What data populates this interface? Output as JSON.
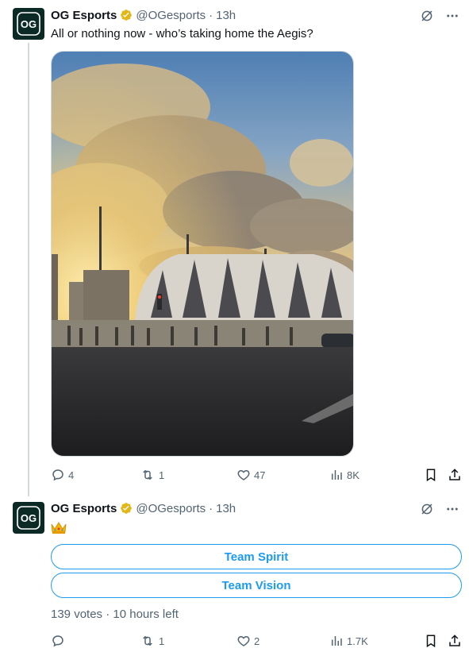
{
  "colors": {
    "accent": "#1d9bf0",
    "muted": "#536471",
    "text": "#0f1419",
    "verified_badge": "#e2b719",
    "avatar_bg": "#0b2a25"
  },
  "tweets": [
    {
      "author": {
        "name": "OG Esports",
        "handle": "@OGesports",
        "verified_icon": "gold-verified-badge-icon",
        "avatar_icon": "og-logo-icon"
      },
      "separator": "·",
      "time": "13h",
      "text": "All or nothing now - who’s taking home the Aegis?",
      "media": {
        "type": "photo",
        "description_icon": "arena-sunset-photo"
      },
      "actions": {
        "replies": "4",
        "reposts": "1",
        "likes": "47",
        "views": "8K"
      }
    },
    {
      "author": {
        "name": "OG Esports",
        "handle": "@OGesports",
        "verified_icon": "gold-verified-badge-icon",
        "avatar_icon": "og-logo-icon"
      },
      "separator": "·",
      "time": "13h",
      "text_icon": "crown-emoji",
      "poll": {
        "options": [
          "Team Spirit",
          "Team Vision"
        ],
        "votes": "139 votes",
        "separator": "·",
        "time_left": "10 hours left"
      },
      "actions": {
        "replies": "",
        "reposts": "1",
        "likes": "2",
        "views": "1.7K"
      }
    }
  ]
}
